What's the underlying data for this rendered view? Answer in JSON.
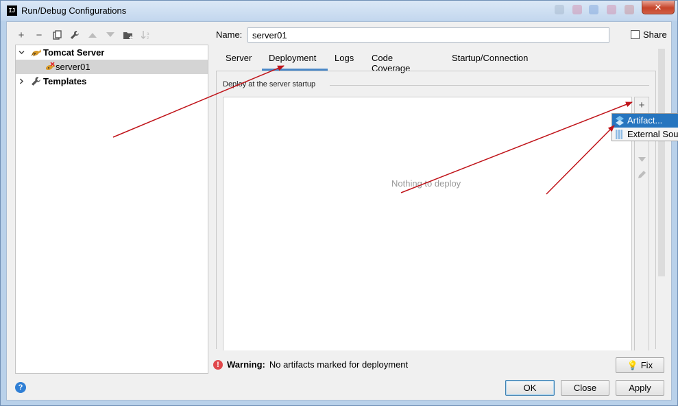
{
  "window": {
    "title": "Run/Debug Configurations",
    "icon_text": "IJ",
    "close_glyph": "✕"
  },
  "left_toolbar": [
    {
      "name": "add-icon",
      "glyph": "+",
      "enabled": true
    },
    {
      "name": "remove-icon",
      "glyph": "−",
      "enabled": true
    },
    {
      "name": "copy-icon",
      "glyph": "⧉",
      "enabled": true
    },
    {
      "name": "wrench-icon",
      "glyph": "🔧",
      "enabled": true
    },
    {
      "name": "move-up-icon",
      "glyph": "▲",
      "enabled": false
    },
    {
      "name": "move-down-icon",
      "glyph": "▼",
      "enabled": false
    },
    {
      "name": "folder-add-icon",
      "glyph": "▆",
      "enabled": true
    },
    {
      "name": "sort-icon",
      "glyph": "↓",
      "enabled": false
    }
  ],
  "tree": {
    "items": [
      {
        "label": "Tomcat Server",
        "bold": true,
        "expanded": true,
        "icon": "tomcat-icon"
      },
      {
        "label": "server01",
        "bold": false,
        "selected": true,
        "icon": "tomcat-error-icon"
      },
      {
        "label": "Templates",
        "bold": true,
        "expanded": false,
        "icon": "wrench-icon"
      }
    ]
  },
  "config": {
    "name_label": "Name:",
    "name_value": "server01",
    "share_label": "Share",
    "share_checked": false
  },
  "tabs": [
    {
      "label": "Server"
    },
    {
      "label": "Deployment",
      "active": true
    },
    {
      "label": "Logs"
    },
    {
      "label": "Code Coverage"
    },
    {
      "label": "Startup/Connection"
    }
  ],
  "deployment": {
    "section_label": "Deploy at the server startup",
    "empty_text": "Nothing to deploy",
    "side_tools": [
      {
        "name": "add-artifact-icon",
        "glyph": "+",
        "enabled": true
      },
      {
        "name": "move-down-icon",
        "glyph": "▼",
        "enabled": false
      },
      {
        "name": "edit-icon",
        "glyph": "✎",
        "enabled": false
      }
    ]
  },
  "popup_menu": {
    "items": [
      {
        "label": "Artifact...",
        "icon": "artifact-icon",
        "highlighted": true
      },
      {
        "label": "External Source...",
        "icon": "external-source-icon",
        "highlighted": false
      }
    ]
  },
  "warning": {
    "label": "Warning:",
    "text": "No artifacts marked for deployment",
    "fix_label": "Fix"
  },
  "buttons": {
    "ok": "OK",
    "close": "Close",
    "apply": "Apply"
  },
  "help": "?",
  "colors": {
    "accent": "#4a88c7",
    "menu_highlight": "#2675bf",
    "annotation_arrow": "#c0141a",
    "warning": "#e0484b"
  }
}
